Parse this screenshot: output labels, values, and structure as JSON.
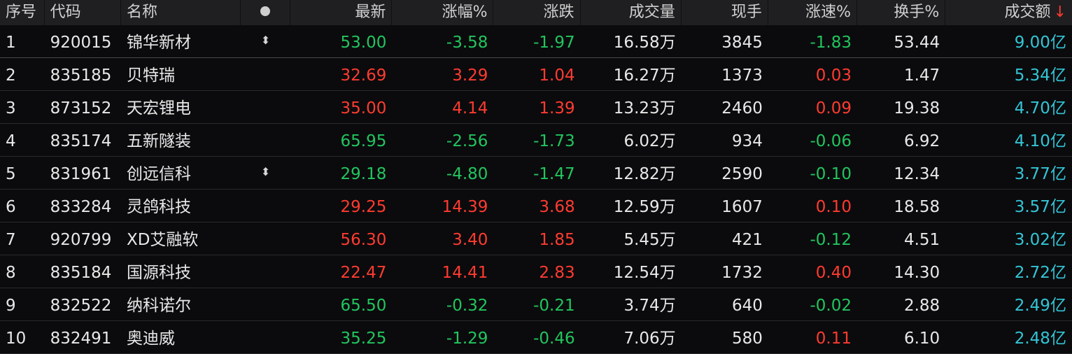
{
  "columns": {
    "idx": "序号",
    "code": "代码",
    "name": "名称",
    "price": "最新",
    "pct": "涨幅%",
    "chg": "涨跌",
    "vol": "成交量",
    "now": "现手",
    "spd": "涨速%",
    "turn": "换手%",
    "amt": "成交额",
    "sort_arrow": "↓"
  },
  "colors": {
    "up": "#ff3b30",
    "down": "#22c55e",
    "amount": "#33c5d6"
  },
  "rows": [
    {
      "idx": "1",
      "code": "920015",
      "name": "锦华新材",
      "marker": "⬍",
      "price": "53.00",
      "pct": "-3.58",
      "chg": "-1.97",
      "vol": "16.58万",
      "now": "3845",
      "spd": "-1.83",
      "turn": "53.44",
      "amt": "9.00亿",
      "dir": "down",
      "spd_dir": "down"
    },
    {
      "idx": "2",
      "code": "835185",
      "name": "贝特瑞",
      "marker": "",
      "price": "32.69",
      "pct": "3.29",
      "chg": "1.04",
      "vol": "16.27万",
      "now": "1373",
      "spd": "0.03",
      "turn": "1.47",
      "amt": "5.34亿",
      "dir": "up",
      "spd_dir": "up"
    },
    {
      "idx": "3",
      "code": "873152",
      "name": "天宏锂电",
      "marker": "",
      "price": "35.00",
      "pct": "4.14",
      "chg": "1.39",
      "vol": "13.23万",
      "now": "2460",
      "spd": "0.09",
      "turn": "19.38",
      "amt": "4.70亿",
      "dir": "up",
      "spd_dir": "up"
    },
    {
      "idx": "4",
      "code": "835174",
      "name": "五新隧装",
      "marker": "",
      "price": "65.95",
      "pct": "-2.56",
      "chg": "-1.73",
      "vol": "6.02万",
      "now": "934",
      "spd": "-0.06",
      "turn": "6.92",
      "amt": "4.10亿",
      "dir": "down",
      "spd_dir": "down"
    },
    {
      "idx": "5",
      "code": "831961",
      "name": "创远信科",
      "marker": "⬍",
      "price": "29.18",
      "pct": "-4.80",
      "chg": "-1.47",
      "vol": "12.82万",
      "now": "2590",
      "spd": "-0.10",
      "turn": "12.34",
      "amt": "3.77亿",
      "dir": "down",
      "spd_dir": "down"
    },
    {
      "idx": "6",
      "code": "833284",
      "name": "灵鸽科技",
      "marker": "",
      "price": "29.25",
      "pct": "14.39",
      "chg": "3.68",
      "vol": "12.59万",
      "now": "1607",
      "spd": "0.10",
      "turn": "18.58",
      "amt": "3.57亿",
      "dir": "up",
      "spd_dir": "up"
    },
    {
      "idx": "7",
      "code": "920799",
      "name": "XD艾融软",
      "marker": "",
      "price": "56.30",
      "pct": "3.40",
      "chg": "1.85",
      "vol": "5.45万",
      "now": "421",
      "spd": "-0.12",
      "turn": "4.51",
      "amt": "3.02亿",
      "dir": "up",
      "spd_dir": "down"
    },
    {
      "idx": "8",
      "code": "835184",
      "name": "国源科技",
      "marker": "",
      "price": "22.47",
      "pct": "14.41",
      "chg": "2.83",
      "vol": "12.54万",
      "now": "1732",
      "spd": "0.40",
      "turn": "14.30",
      "amt": "2.72亿",
      "dir": "up",
      "spd_dir": "up"
    },
    {
      "idx": "9",
      "code": "832522",
      "name": "纳科诺尔",
      "marker": "",
      "price": "65.50",
      "pct": "-0.32",
      "chg": "-0.21",
      "vol": "3.74万",
      "now": "640",
      "spd": "-0.02",
      "turn": "2.88",
      "amt": "2.49亿",
      "dir": "down",
      "spd_dir": "down"
    },
    {
      "idx": "10",
      "code": "832491",
      "name": "奥迪威",
      "marker": "",
      "price": "35.25",
      "pct": "-1.29",
      "chg": "-0.46",
      "vol": "7.06万",
      "now": "580",
      "spd": "0.11",
      "turn": "6.10",
      "amt": "2.48亿",
      "dir": "down",
      "spd_dir": "up"
    }
  ]
}
